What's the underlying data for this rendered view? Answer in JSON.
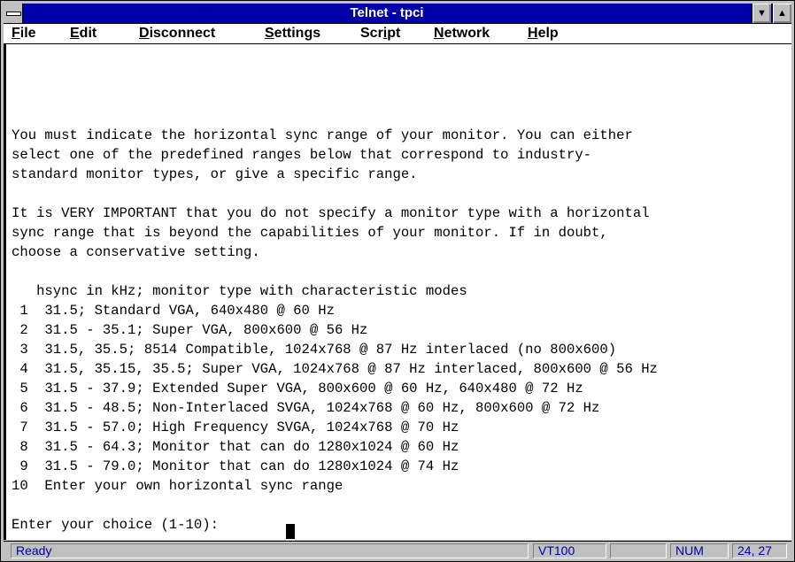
{
  "window": {
    "title": "Telnet - tpci"
  },
  "menu": {
    "file": {
      "mnemonic": "F",
      "rest": "ile"
    },
    "edit": {
      "mnemonic": "E",
      "rest": "dit"
    },
    "disconnect": {
      "mnemonic": "D",
      "rest": "isconnect"
    },
    "settings": {
      "mnemonic": "S",
      "rest": "ettings"
    },
    "script": {
      "pre": "Scr",
      "mnemonic": "i",
      "rest": "pt"
    },
    "network": {
      "mnemonic": "N",
      "rest": "etwork"
    },
    "help": {
      "mnemonic": "H",
      "rest": "elp"
    }
  },
  "terminal": {
    "lines": [
      "You must indicate the horizontal sync range of your monitor. You can either",
      "select one of the predefined ranges below that correspond to industry-",
      "standard monitor types, or give a specific range.",
      "",
      "It is VERY IMPORTANT that you do not specify a monitor type with a horizontal",
      "sync range that is beyond the capabilities of your monitor. If in doubt,",
      "choose a conservative setting.",
      "",
      "   hsync in kHz; monitor type with characteristic modes",
      " 1  31.5; Standard VGA, 640x480 @ 60 Hz",
      " 2  31.5 - 35.1; Super VGA, 800x600 @ 56 Hz",
      " 3  31.5, 35.5; 8514 Compatible, 1024x768 @ 87 Hz interlaced (no 800x600)",
      " 4  31.5, 35.15, 35.5; Super VGA, 1024x768 @ 87 Hz interlaced, 800x600 @ 56 Hz",
      " 5  31.5 - 37.9; Extended Super VGA, 800x600 @ 60 Hz, 640x480 @ 72 Hz",
      " 6  31.5 - 48.5; Non-Interlaced SVGA, 1024x768 @ 60 Hz, 800x600 @ 72 Hz",
      " 7  31.5 - 57.0; High Frequency SVGA, 1024x768 @ 70 Hz",
      " 8  31.5 - 64.3; Monitor that can do 1280x1024 @ 60 Hz",
      " 9  31.5 - 79.0; Monitor that can do 1280x1024 @ 74 Hz",
      "10  Enter your own horizontal sync range",
      "",
      "Enter your choice (1-10): "
    ]
  },
  "statusbar": {
    "status": "Ready",
    "emulation": "VT100",
    "empty": "",
    "numlock": "NUM",
    "position": "24, 27"
  }
}
